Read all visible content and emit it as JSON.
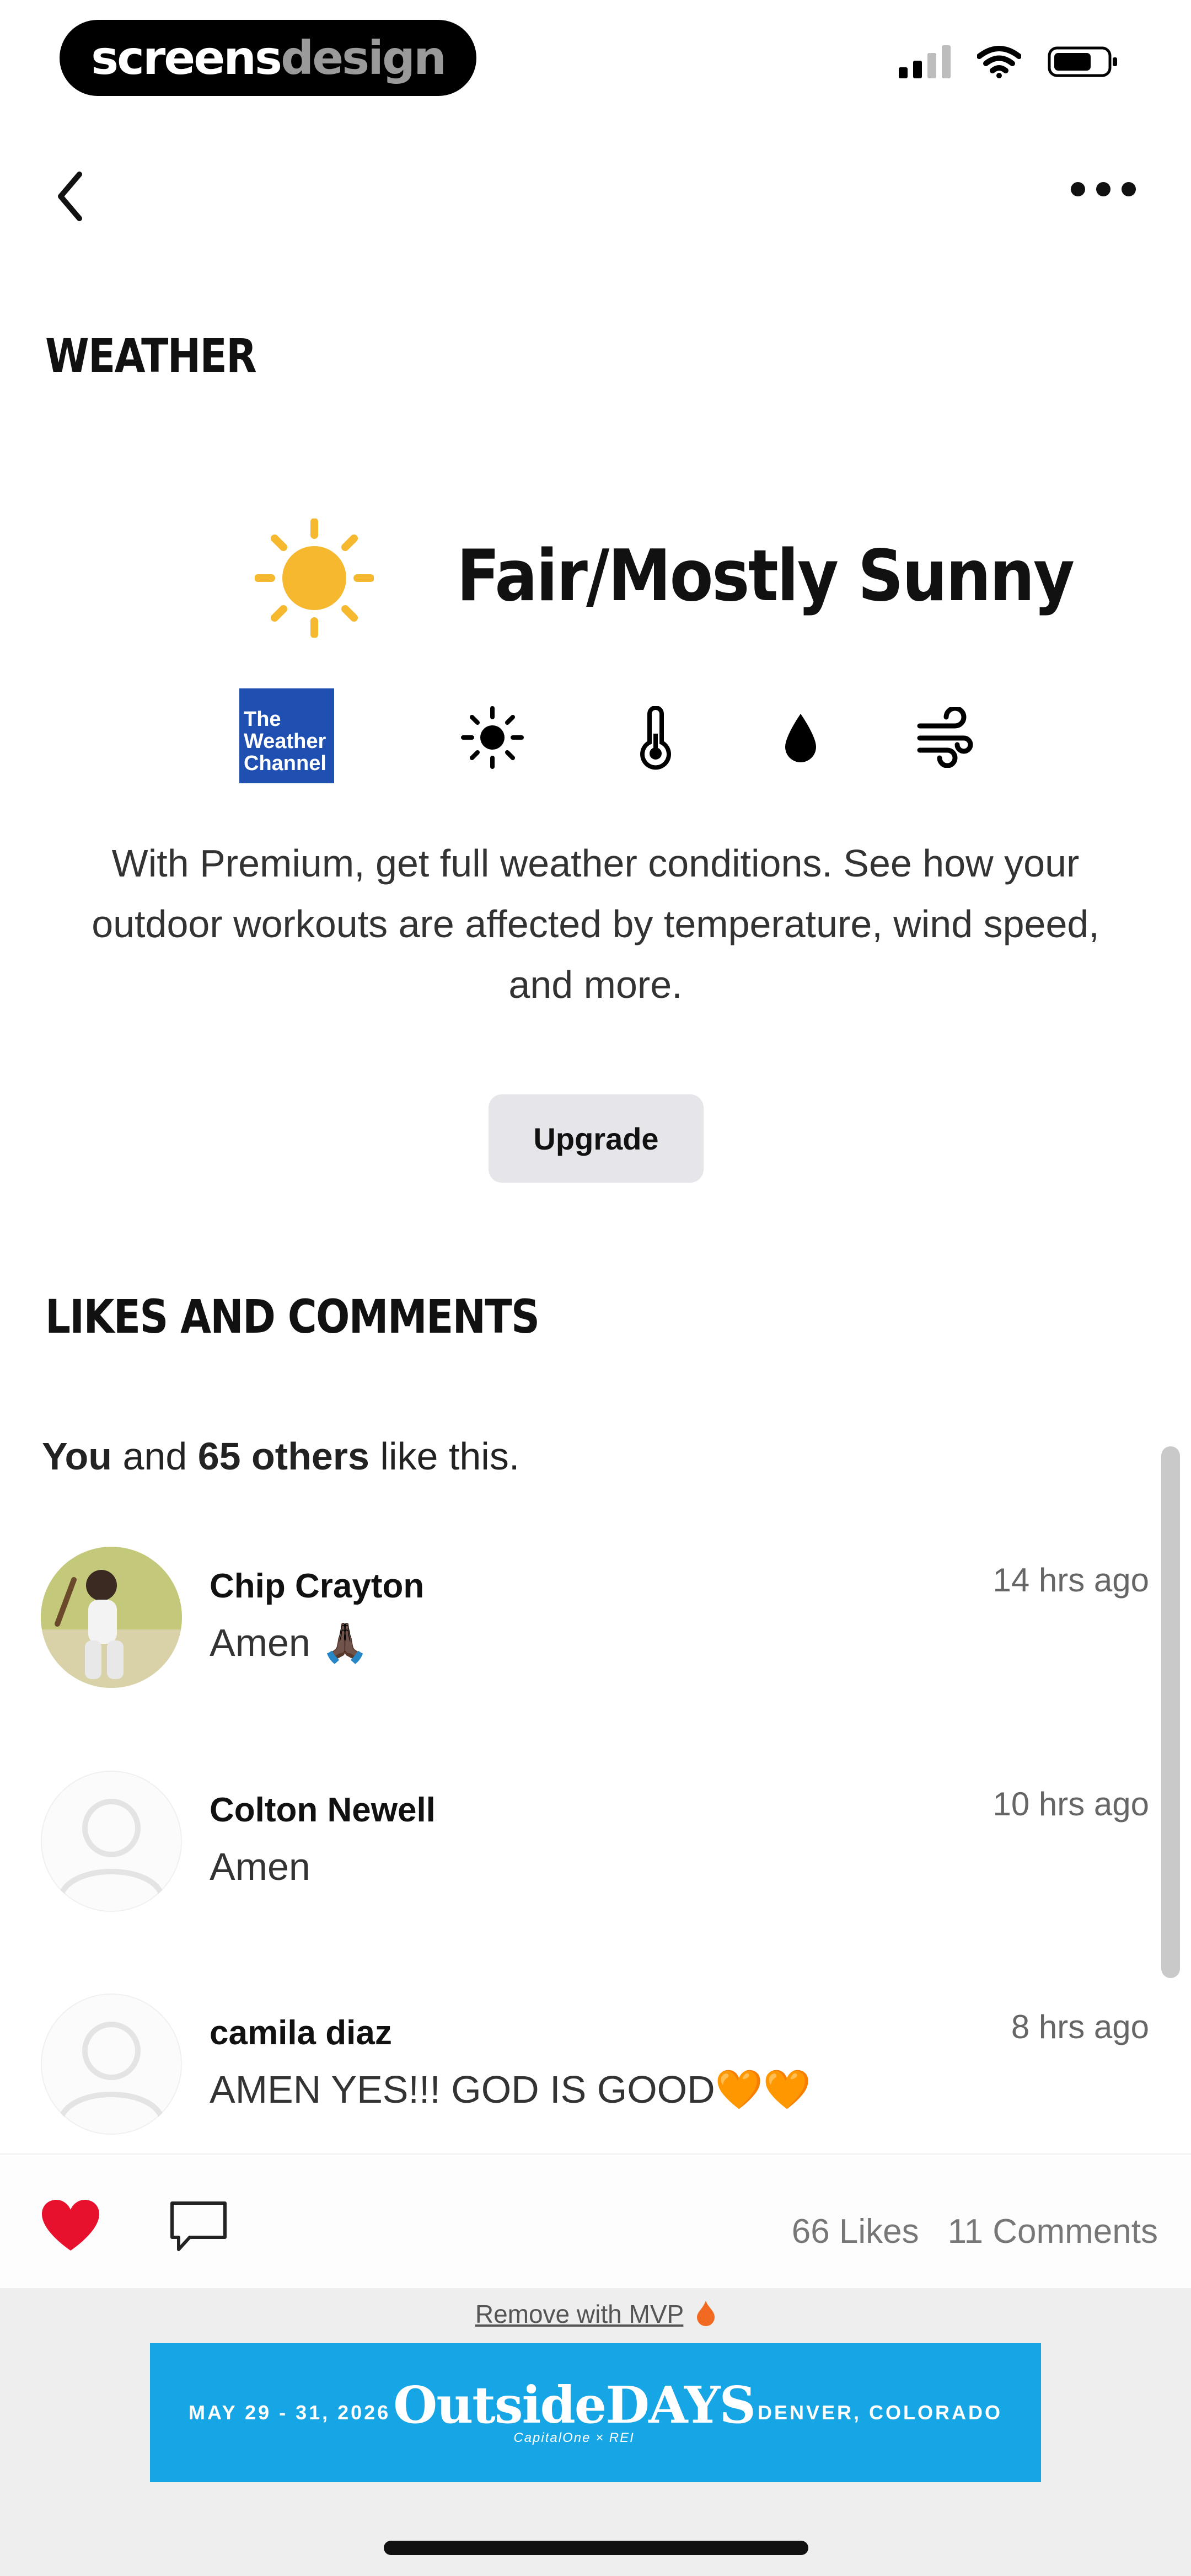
{
  "status_bar": {
    "brand_part1": "screens",
    "brand_part2": "design"
  },
  "weather": {
    "section_title": "WEATHER",
    "condition": "Fair/Mostly Sunny",
    "logo_text": "The Weather Channel",
    "premium_message": "With Premium, get full weather conditions. See how your outdoor workouts are affected by temperature, wind speed, and more.",
    "upgrade_label": "Upgrade",
    "icons": [
      "sun-icon",
      "thermometer-icon",
      "droplet-icon",
      "wind-icon"
    ]
  },
  "likes": {
    "section_title": "LIKES AND COMMENTS",
    "you": "You",
    "and": " and ",
    "others": "65 others",
    "suffix": " like this."
  },
  "comments": [
    {
      "name": "Chip Crayton",
      "text": "Amen 🙏🏿",
      "time": "14 hrs ago"
    },
    {
      "name": "Colton Newell",
      "text": "Amen",
      "time": "10 hrs ago"
    },
    {
      "name": "camila diaz",
      "text": "AMEN YES!!! GOD IS GOOD🧡🧡",
      "time": "8 hrs ago"
    }
  ],
  "action_bar": {
    "likes_count": "66 Likes",
    "comments_count": "11 Comments"
  },
  "ad": {
    "remove_label": "Remove with MVP",
    "dates": "MAY 29 - 31, 2026",
    "title": "OutsideDAYS",
    "sponsors": "CapitalOne × REI",
    "location": "DENVER, COLORADO"
  },
  "colors": {
    "heart": "#e8112d",
    "sun": "#f5b82e",
    "weather_logo": "#1f4fb0",
    "ad_background": "#16a6e6"
  }
}
